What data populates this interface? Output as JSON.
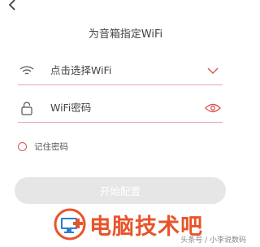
{
  "header": {
    "title": "为音箱指定WiFi"
  },
  "wifi": {
    "text": "点击选择WiFi"
  },
  "password": {
    "text": "WiFi密码"
  },
  "remember": {
    "label": "记住密码"
  },
  "action": {
    "label": "开始配置"
  },
  "watermark": {
    "brand": "电脑技术吧",
    "credit": "头条号 / 小李说数码"
  },
  "colors": {
    "accent": "#d9534f",
    "brand": "#e8542a",
    "button_bg": "#e6e6e6"
  },
  "icons": [
    "back-icon",
    "wifi-icon",
    "chevron-down-icon",
    "lock-icon",
    "eye-icon",
    "logo-icon"
  ]
}
